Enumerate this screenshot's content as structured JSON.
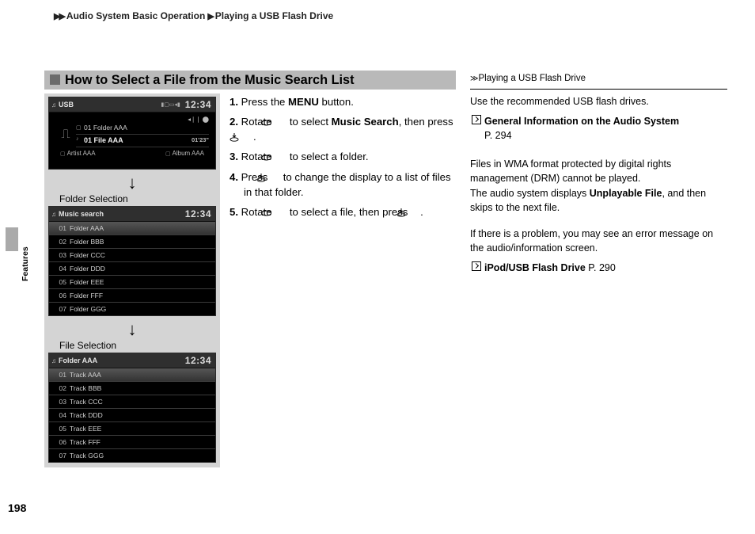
{
  "breadcrumb": {
    "a": "Audio System Basic Operation",
    "b": "Playing a USB Flash Drive"
  },
  "sideTab": "Features",
  "pageNumber": "198",
  "heading": "How to Select a File from the Music Search List",
  "screens": {
    "clock": "12:34",
    "usb": {
      "title": "USB",
      "line1": "01  Folder AAA",
      "line2": "01 File AAA",
      "dur": "01'23\"",
      "metaL": "Artist AAA",
      "metaR": "Album AAA"
    },
    "cap1": "Folder Selection",
    "folders": {
      "title": "Music search",
      "items": [
        {
          "n": "01",
          "t": "Folder AAA"
        },
        {
          "n": "02",
          "t": "Folder BBB"
        },
        {
          "n": "03",
          "t": "Folder CCC"
        },
        {
          "n": "04",
          "t": "Folder DDD"
        },
        {
          "n": "05",
          "t": "Folder EEE"
        },
        {
          "n": "06",
          "t": "Folder FFF"
        },
        {
          "n": "07",
          "t": "Folder GGG"
        }
      ]
    },
    "cap2": "File Selection",
    "tracks": {
      "title": "Folder AAA",
      "items": [
        {
          "n": "01",
          "t": "Track AAA"
        },
        {
          "n": "02",
          "t": "Track BBB"
        },
        {
          "n": "03",
          "t": "Track CCC"
        },
        {
          "n": "04",
          "t": "Track DDD"
        },
        {
          "n": "05",
          "t": "Track EEE"
        },
        {
          "n": "06",
          "t": "Track FFF"
        },
        {
          "n": "07",
          "t": "Track GGG"
        }
      ]
    }
  },
  "steps": {
    "s1_a": "Press the ",
    "s1_b": "MENU",
    "s1_c": " button.",
    "s2_a": "Rotate ",
    "s2_b": " to select ",
    "s2_c": "Music Search",
    "s2_d": ", then press ",
    "s2_e": ".",
    "s3_a": "Rotate ",
    "s3_b": " to select a folder.",
    "s4_a": "Press ",
    "s4_b": " to change the display to a list of files in that folder.",
    "s5_a": "Rotate ",
    "s5_b": " to select a file, then press ",
    "s5_c": "."
  },
  "right": {
    "head": "Playing a USB Flash Drive",
    "p1": "Use the recommended USB flash drives.",
    "x1a": "General Information on the Audio System",
    "x1b": "P. 294",
    "p2a": "Files in WMA format protected by digital rights management (DRM) cannot be played.",
    "p2b_a": "The audio system displays ",
    "p2b_b": "Unplayable File",
    "p2b_c": ", and then skips to the next file.",
    "p3": "If there is a problem, you may see an error message on the audio/information screen.",
    "x2a": "iPod/USB Flash Drive",
    "x2b": "P. 290"
  }
}
